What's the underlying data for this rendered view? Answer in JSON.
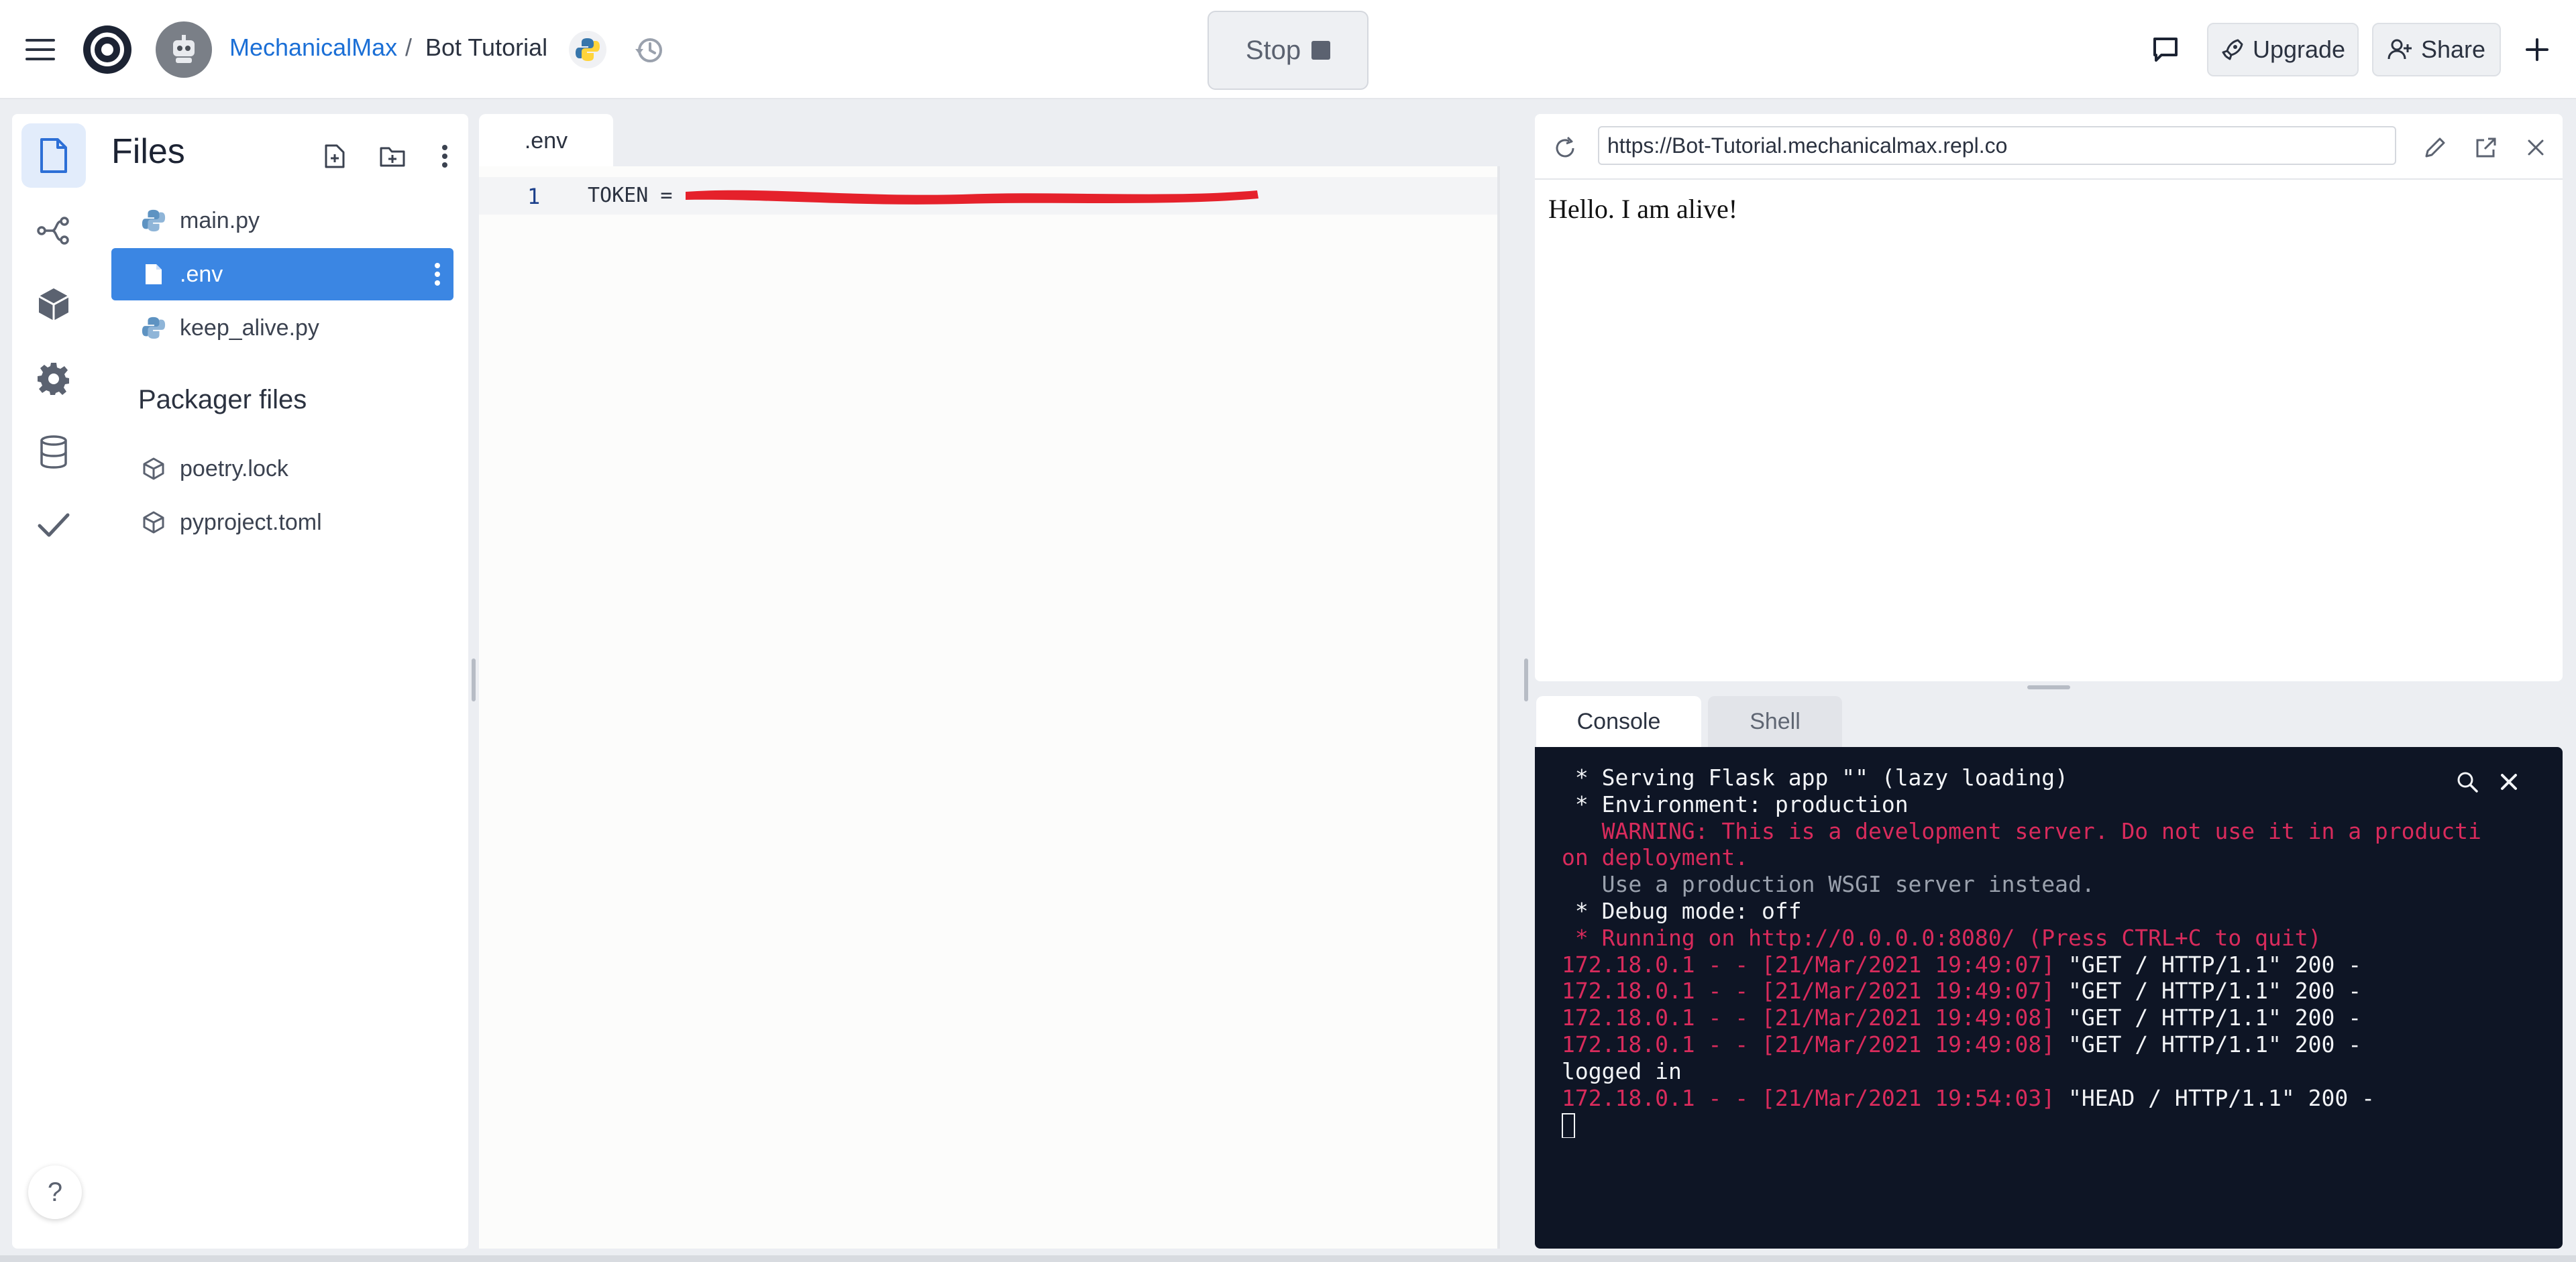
{
  "header": {
    "owner": "MechanicalMax",
    "separator": "/",
    "repl_name": "Bot Tutorial",
    "stop_label": "Stop",
    "upgrade_label": "Upgrade",
    "share_label": "Share"
  },
  "files": {
    "title": "Files",
    "items": [
      {
        "name": "main.py",
        "icon": "python-icon"
      },
      {
        "name": ".env",
        "icon": "file-icon",
        "selected": true
      },
      {
        "name": "keep_alive.py",
        "icon": "python-icon"
      }
    ],
    "packager_title": "Packager files",
    "packager_items": [
      {
        "name": "poetry.lock",
        "icon": "package-icon"
      },
      {
        "name": "pyproject.toml",
        "icon": "package-icon"
      }
    ]
  },
  "editor": {
    "tab_label": ".env",
    "line_number": "1",
    "line_text": "TOKEN = "
  },
  "webview": {
    "url": "https://Bot-Tutorial.mechanicalmax.repl.co",
    "content": "Hello. I am alive!"
  },
  "console_tabs": {
    "console": "Console",
    "shell": "Shell"
  },
  "console": {
    "lines": [
      {
        "text": " * Serving Flask app \"\" (lazy loading)",
        "color": "white"
      },
      {
        "text": " * Environment: production",
        "color": "white"
      },
      {
        "text": "   WARNING: This is a development server. Do not use it in a producti",
        "color": "red"
      },
      {
        "text": "on deployment.",
        "color": "red"
      },
      {
        "text": "   Use a production WSGI server instead.",
        "color": "grey"
      },
      {
        "text": " * Debug mode: off",
        "color": "white"
      },
      {
        "text": " * Running on http://0.0.0.0:8080/ (Press CTRL+C to quit)",
        "color": "red"
      },
      {
        "prefix": "172.18.0.1 - - [21/Mar/2021 19:49:07] ",
        "text": "\"GET / HTTP/1.1\" 200 -",
        "color": "white"
      },
      {
        "prefix": "172.18.0.1 - - [21/Mar/2021 19:49:07] ",
        "text": "\"GET / HTTP/1.1\" 200 -",
        "color": "white"
      },
      {
        "prefix": "172.18.0.1 - - [21/Mar/2021 19:49:08] ",
        "text": "\"GET / HTTP/1.1\" 200 -",
        "color": "white"
      },
      {
        "prefix": "172.18.0.1 - - [21/Mar/2021 19:49:08] ",
        "text": "\"GET / HTTP/1.1\" 200 -",
        "color": "white"
      },
      {
        "text": "logged in",
        "color": "white"
      },
      {
        "prefix": "172.18.0.1 - - [21/Mar/2021 19:54:03] ",
        "text": "\"HEAD / HTTP/1.1\" 200 -",
        "color": "white"
      }
    ]
  },
  "colors": {
    "accent": "#3b86e3",
    "link": "#1b6fd6",
    "console_bg": "#0e1525",
    "console_red": "#d92b5c"
  }
}
